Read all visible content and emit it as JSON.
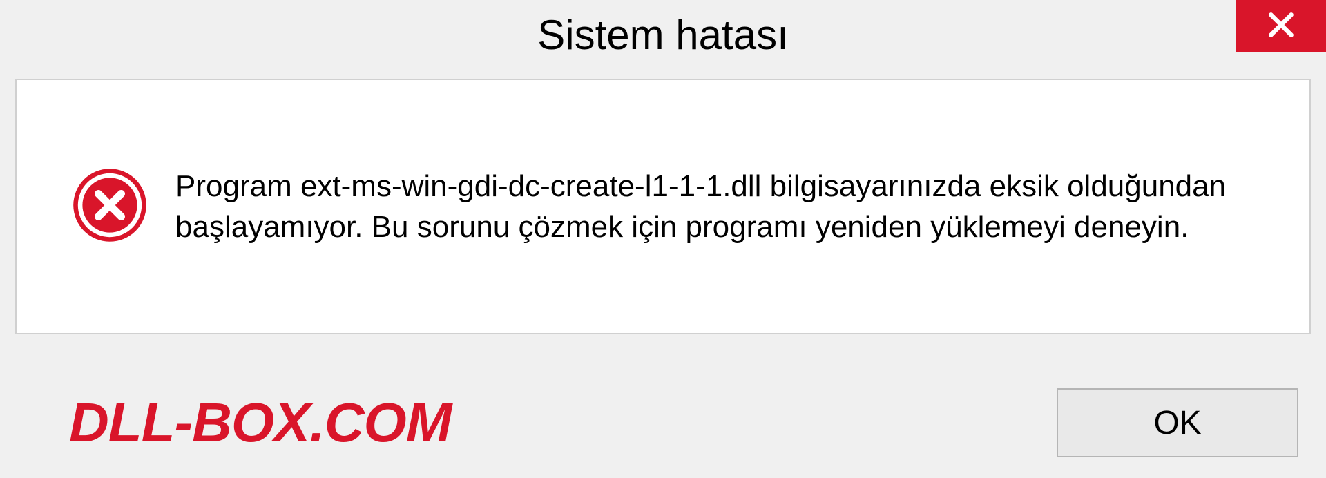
{
  "dialog": {
    "title": "Sistem hatası",
    "message": "Program ext-ms-win-gdi-dc-create-l1-1-1.dll bilgisayarınızda eksik olduğundan başlayamıyor. Bu sorunu çözmek için programı yeniden yüklemeyi deneyin.",
    "ok_label": "OK"
  },
  "brand": {
    "text": "DLL-BOX.COM"
  },
  "colors": {
    "accent": "#d9152a"
  }
}
